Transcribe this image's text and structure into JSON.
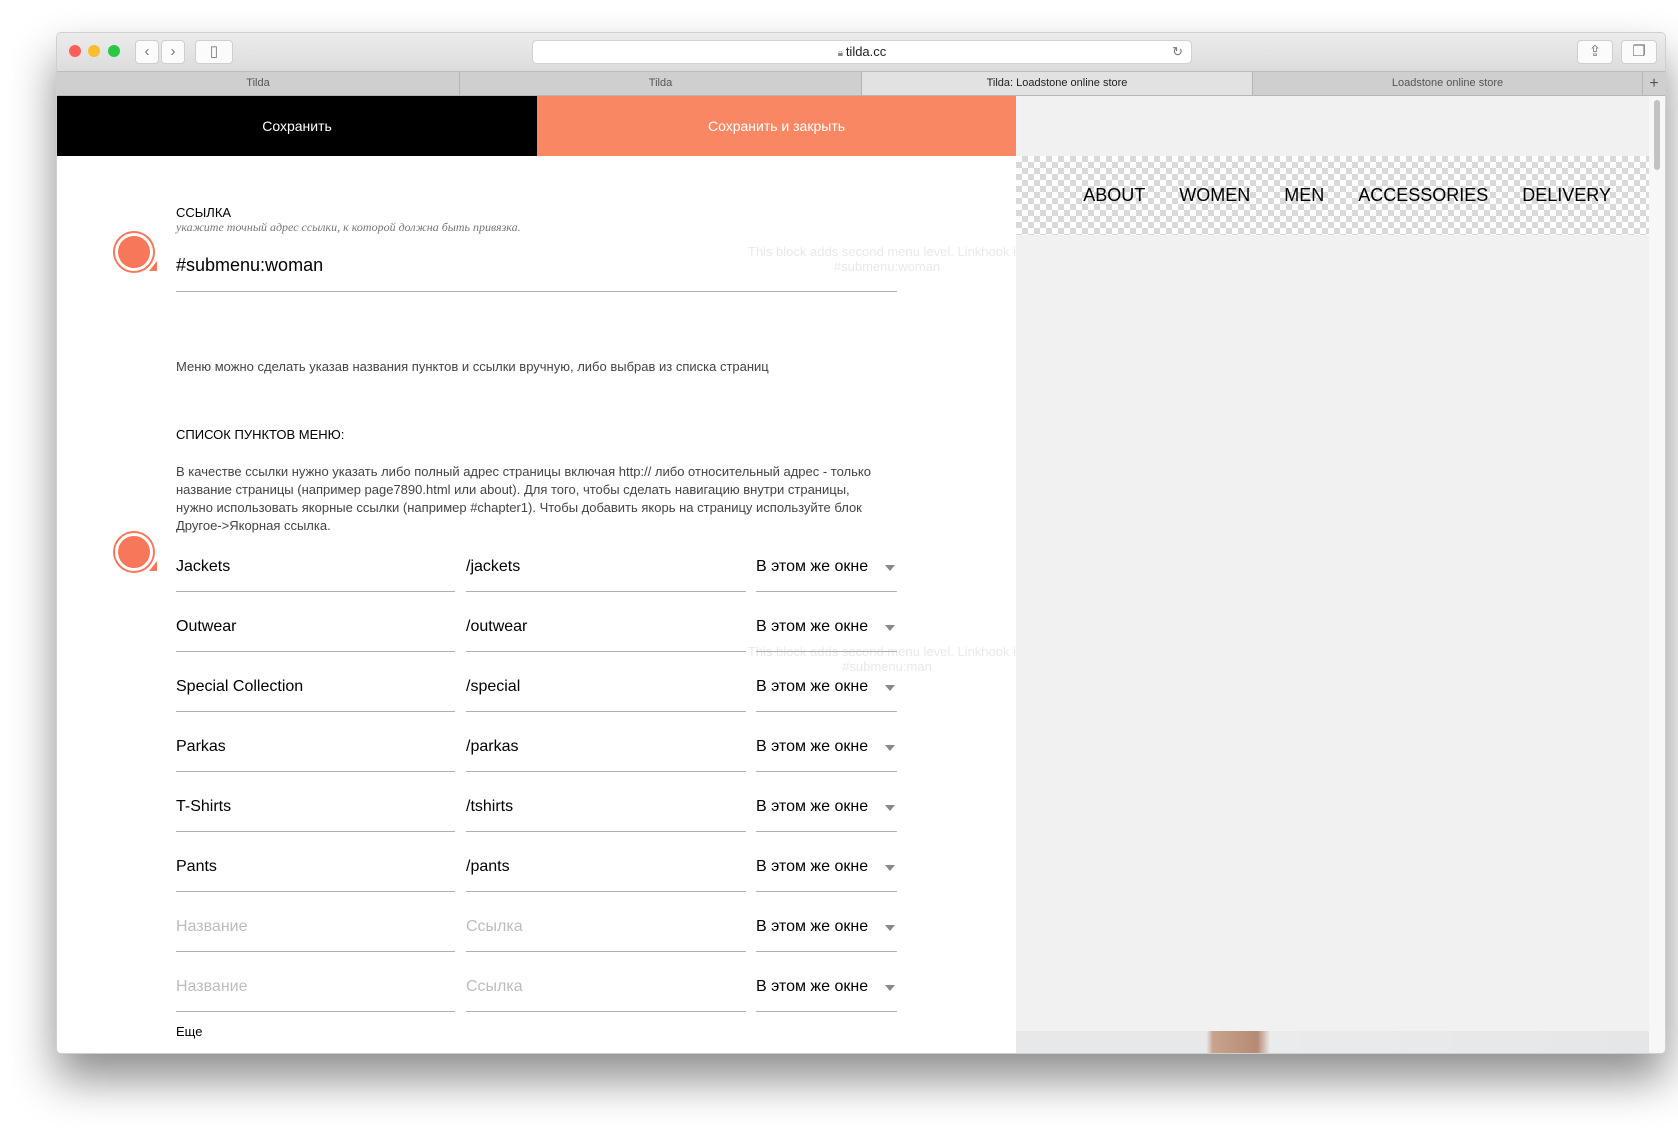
{
  "browser": {
    "url": "tilda.cc",
    "tabs": [
      {
        "label": "Tilda",
        "active": false
      },
      {
        "label": "Tilda",
        "active": false
      },
      {
        "label": "Tilda: Loadstone online store",
        "active": true
      },
      {
        "label": "Loadstone online store",
        "active": false
      }
    ]
  },
  "editor": {
    "save_label": "Сохранить",
    "save_close_label": "Сохранить и закрыть",
    "link_label": "ССЫЛКА",
    "link_hint": "укажите точный адрес ссылки, к которой должна быть привязка.",
    "link_value": "#submenu:woman",
    "menu_description": "Меню можно сделать указав названия пунктов и ссылки вручную, либо выбрав из списка страниц",
    "list_header": "СПИСОК ПУНКТОВ МЕНЮ:",
    "list_hint": "В качестве ссылки нужно указать либо полный адрес страницы включая http:// либо относительный адрес - только название страницы (например page7890.html или about). Для того, чтобы сделать навигацию внутри страницы, нужно использовать якорные ссылки (например #chapter1). Чтобы добавить якорь на страницу используйте блок Другое->Якорная ссылка.",
    "items": [
      {
        "name": "Jackets",
        "link": "/jackets",
        "target": "В этом же окне"
      },
      {
        "name": "Outwear",
        "link": "/outwear",
        "target": "В этом же окне"
      },
      {
        "name": "Special Collection",
        "link": "/special",
        "target": "В этом же окне"
      },
      {
        "name": "Parkas",
        "link": "/parkas",
        "target": "В этом же окне"
      },
      {
        "name": "T-Shirts",
        "link": "/tshirts",
        "target": "В этом же окне"
      },
      {
        "name": "Pants",
        "link": "/pants",
        "target": "В этом же окне"
      },
      {
        "name": "",
        "link": "",
        "target": "В этом же окне"
      },
      {
        "name": "",
        "link": "",
        "target": "В этом же окне"
      }
    ],
    "name_placeholder": "Название",
    "link_placeholder": "Ссылка",
    "more_label": "Еще"
  },
  "background_ghost": {
    "woman_note": "This block adds second menu level. Linkhook is: #submenu:woman",
    "man_note": "This block adds second menu level. Linkhook is: #submenu:man"
  },
  "preview": {
    "nav": [
      "ABOUT",
      "WOMEN",
      "MEN",
      "ACCESSORIES",
      "DELIVERY"
    ]
  },
  "colors": {
    "accent": "#fa8764",
    "marker": "#f7775a"
  }
}
